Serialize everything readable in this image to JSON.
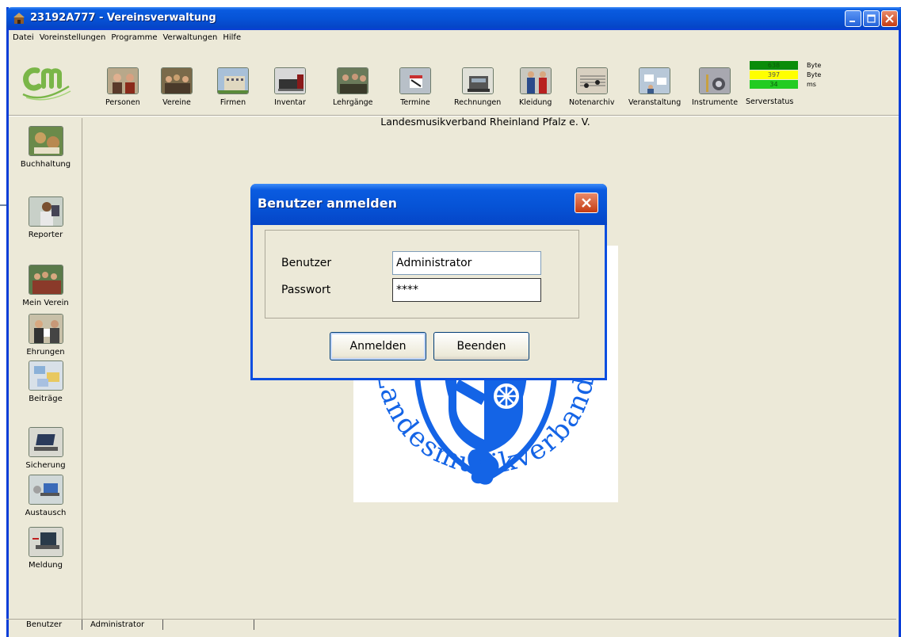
{
  "window": {
    "title": "23192A777 - Vereinsverwaltung"
  },
  "menu": [
    "Datei",
    "Voreinstellungen",
    "Programme",
    "Verwaltungen",
    "Hilfe"
  ],
  "logo_text": "cm",
  "toolbar": {
    "items": [
      {
        "label": "Personen",
        "icon": "people-photo-icon"
      },
      {
        "label": "Vereine",
        "icon": "club-group-photo-icon"
      },
      {
        "label": "Firmen",
        "icon": "building-photo-icon"
      },
      {
        "label": "Inventar",
        "icon": "inventory-photo-icon"
      },
      {
        "label": "Lehrgänge",
        "icon": "course-photo-icon"
      },
      {
        "label": "Termine",
        "icon": "calendar-photo-icon"
      },
      {
        "label": "Rechnungen",
        "icon": "cash-register-icon"
      },
      {
        "label": "Kleidung",
        "icon": "uniform-photo-icon"
      },
      {
        "label": "Notenarchiv",
        "icon": "sheet-music-icon"
      },
      {
        "label": "Veranstaltung",
        "icon": "event-photo-icon"
      },
      {
        "label": "Instrumente",
        "icon": "instruments-photo-icon"
      }
    ]
  },
  "server_status": {
    "label": "Serverstatus",
    "rows": [
      {
        "value": "638",
        "unit": "Byte",
        "color": "#0a8c0a"
      },
      {
        "value": "397",
        "unit": "Byte",
        "color": "#ffff00"
      },
      {
        "value": "34",
        "unit": "ms",
        "color": "#22cc22"
      }
    ]
  },
  "sidebar": {
    "items": [
      {
        "label": "Buchhaltung",
        "icon": "accounting-photo-icon"
      },
      {
        "label": "Reporter",
        "icon": "reporter-photo-icon"
      },
      {
        "label": "Mein Verein",
        "icon": "my-club-photo-icon"
      },
      {
        "label": "Ehrungen",
        "icon": "honors-photo-icon"
      },
      {
        "label": "Beiträge",
        "icon": "contributions-photo-icon"
      },
      {
        "label": "Sicherung",
        "icon": "laptop-backup-icon"
      },
      {
        "label": "Austausch",
        "icon": "laptop-exchange-icon"
      },
      {
        "label": "Meldung",
        "icon": "laptop-report-icon"
      }
    ]
  },
  "organization": "Landesmusikverband Rheinland Pfalz e. V.",
  "emblem": {
    "ring_text": "Landesmusikverband Rheinland-Pfalz",
    "color": "#1464e6"
  },
  "dialog": {
    "title": "Benutzer anmelden",
    "user_label": "Benutzer",
    "user_value": "Administrator",
    "password_label": "Passwort",
    "password_value": "****",
    "login_button": "Anmelden",
    "quit_button": "Beenden"
  },
  "status_bar": {
    "user_label": "Benutzer",
    "user_value": "Administrator"
  }
}
